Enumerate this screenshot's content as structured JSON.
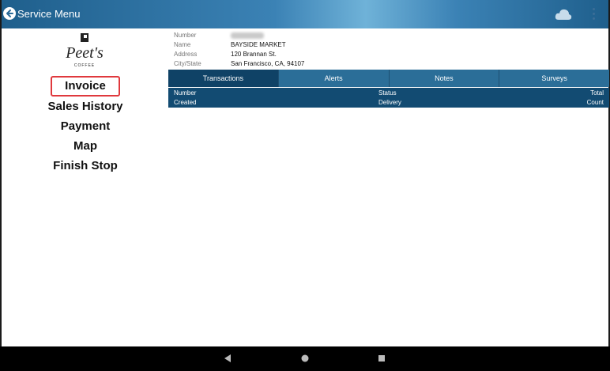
{
  "appbar": {
    "title": "Service Menu",
    "back_icon": "arrow-left-icon",
    "cloud_icon": "cloud-icon",
    "menu_icon": "more-vertical-icon"
  },
  "logo": {
    "line1": "Peet's",
    "line2": "COFFEE"
  },
  "nav": [
    {
      "label": "Invoice",
      "active": true
    },
    {
      "label": "Sales History"
    },
    {
      "label": "Payment"
    },
    {
      "label": "Map"
    },
    {
      "label": "Finish Stop"
    }
  ],
  "customer": {
    "labels": [
      "Number",
      "Name",
      "Address",
      "City/State"
    ],
    "values": {
      "number": "",
      "name": "BAYSIDE MARKET",
      "address": "120 Brannan St.",
      "city_state": "San Francisco, CA, 94107"
    }
  },
  "tabs": [
    "Transactions",
    "Alerts",
    "Notes",
    "Surveys"
  ],
  "table": {
    "row1": [
      "Number",
      "Status",
      "Total"
    ],
    "row2": [
      "Created",
      "Delivery",
      "Count"
    ]
  },
  "colors": {
    "appbar": "#2f78ad",
    "tab_active": "#0f4266",
    "tab": "#2b6e98",
    "highlight": "#e0393d"
  }
}
